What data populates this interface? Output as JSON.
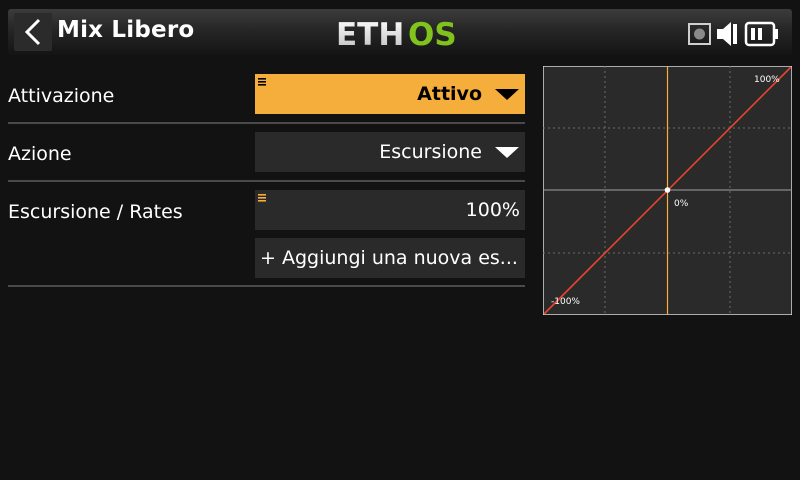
{
  "header": {
    "title": "Mix Libero",
    "logo_text_white": "ETH",
    "logo_text_green": "OS",
    "back_icon": "chevron-left-icon",
    "status_icons": [
      "sd-card-icon",
      "speaker-icon",
      "battery-icon"
    ],
    "logo_green": "#7fc31c"
  },
  "form": {
    "rows": [
      {
        "label": "Attivazione",
        "value": "Attivo",
        "active": true
      },
      {
        "label": "Azione",
        "value": "Escursione",
        "active": false
      },
      {
        "label": "Escursione / Rates",
        "value": "100%",
        "active": false
      }
    ],
    "add_rate_label": "+ Aggiungi una nuova es..."
  },
  "graph": {
    "label_max": "100%",
    "label_center": "0%",
    "label_min": "-100%",
    "line_color": "#e8462c",
    "axis_color": "#f5ad3b",
    "accent": "#f5ad3b"
  }
}
